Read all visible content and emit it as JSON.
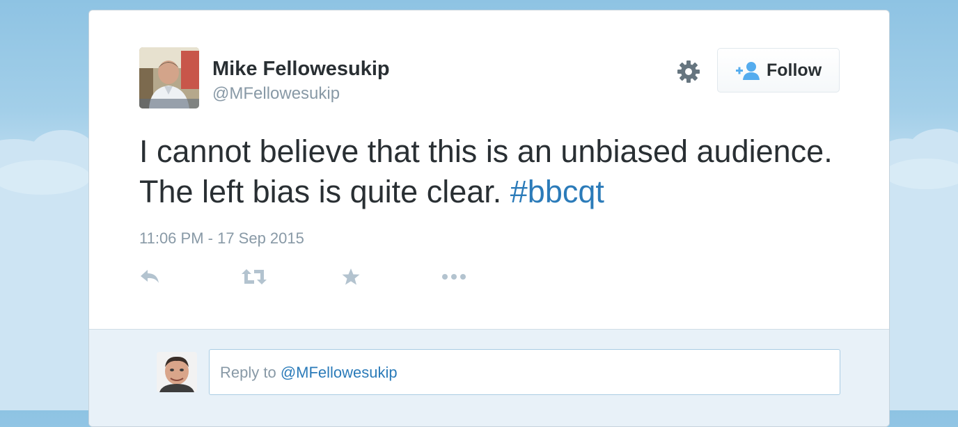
{
  "author": {
    "display_name": "Mike Fellowesukip",
    "handle": "@MFellowesukip"
  },
  "header": {
    "settings_icon": "gear-icon",
    "follow_label": "Follow",
    "follow_icon": "add-user-icon"
  },
  "tweet": {
    "text": "I cannot believe that this is an unbiased audience.  The left bias is quite clear. ",
    "hashtag": "#bbcqt",
    "timestamp": "11:06 PM - 17 Sep 2015"
  },
  "actions": {
    "reply_icon": "reply-icon",
    "retweet_icon": "retweet-icon",
    "favorite_icon": "star-icon",
    "more_icon": "more-dots-icon"
  },
  "reply": {
    "prefix": "Reply to ",
    "mention": "@MFellowesukip"
  },
  "colors": {
    "link": "#2b7bb9",
    "text": "#292f33",
    "muted": "#8899a6",
    "sky": "#8ec3e3",
    "reply_area": "#e8f1f8"
  }
}
